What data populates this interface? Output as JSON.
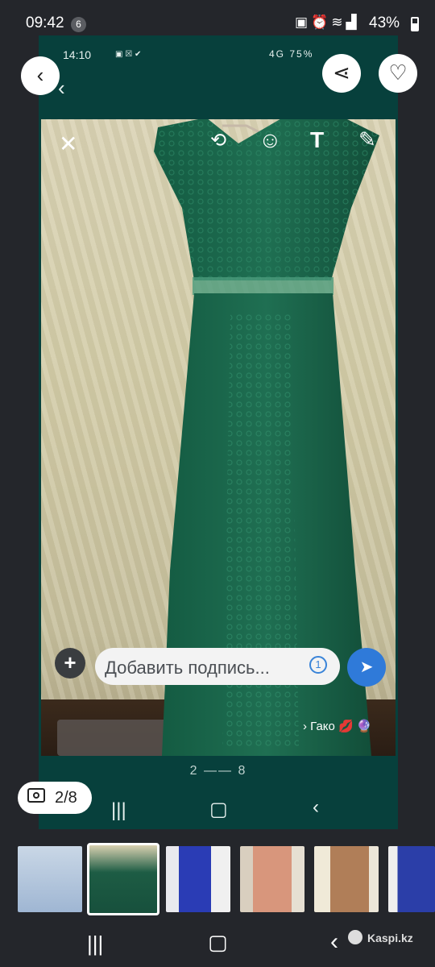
{
  "status_bar": {
    "time": "09:42",
    "notification_count": "6",
    "icons": [
      "lock-icon",
      "alarm-icon",
      "wifi-icon",
      "signal-icon"
    ],
    "battery": "43%"
  },
  "inner_screen": {
    "time": "14:10",
    "status_right": "4G 75%",
    "caption_placeholder": "Добавить подпись...",
    "timer_badge": "1",
    "recipient": "› Гако 💋 🔮",
    "page_indicator": "2 —— 8"
  },
  "header": {
    "back_icon": "chevron-left-icon",
    "share_icon": "share-icon",
    "like_icon": "heart-icon"
  },
  "photo_counter": "2/8",
  "thumbnails": [
    {
      "name": "thumb-1",
      "color": "#b9cbe0",
      "selected": false
    },
    {
      "name": "thumb-2",
      "color": "#1f5c44",
      "selected": true
    },
    {
      "name": "thumb-3",
      "color": "#2f3fb0",
      "selected": false
    },
    {
      "name": "thumb-4",
      "color": "#d59a80",
      "selected": false
    },
    {
      "name": "thumb-5",
      "color": "#b58a5e",
      "selected": false
    },
    {
      "name": "thumb-6",
      "color": "#2b3ea8",
      "selected": false
    }
  ],
  "watermark": "Kaspi.kz",
  "colors": {
    "inner_bg": "#07403c",
    "send_button": "#2f7ad9",
    "dress": "#1f6b4f"
  }
}
